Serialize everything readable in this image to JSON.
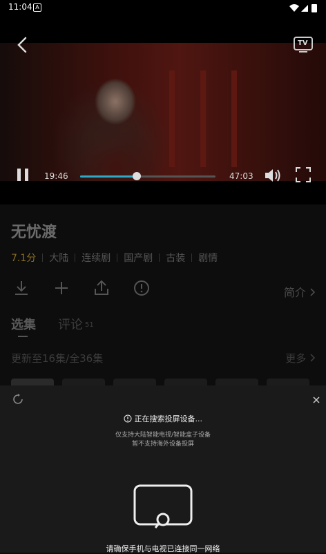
{
  "status_bar": {
    "time": "11:04",
    "notification_glyph": "A"
  },
  "player": {
    "current_time": "19:46",
    "duration": "47:03",
    "progress": 0.42,
    "accent_color": "#2ea9c8",
    "tv_badge": "TV"
  },
  "show": {
    "title": "无忧渡",
    "rating": "7.1分",
    "tags": [
      "大陆",
      "连续剧",
      "国产剧",
      "古装",
      "剧情"
    ],
    "rating_color": "#8a6d1e"
  },
  "actions": {
    "intro_label": "简介"
  },
  "tabs": {
    "episodes_label": "选集",
    "comments_label": "评论",
    "comments_count": "51"
  },
  "episodes": {
    "update_text": "更新至16集/全36集",
    "more_label": "更多"
  },
  "cast_sheet": {
    "status": "正在搜索投屏设备...",
    "note_line1": "仅支持大陆智能电视/智能盒子设备",
    "note_line2": "暂不支持海外设备投屏",
    "bottom_hint": "请确保手机与电视已连接同一网络"
  }
}
